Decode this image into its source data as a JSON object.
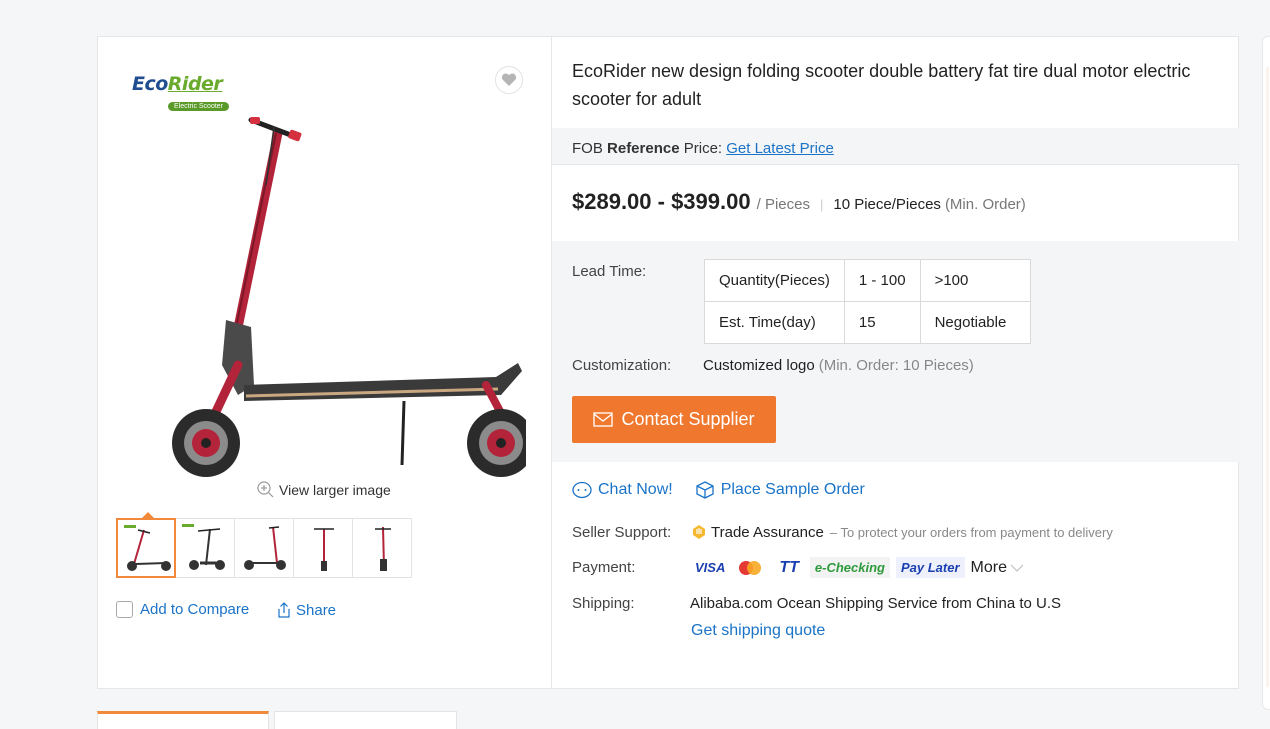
{
  "product": {
    "brand": {
      "logo_eco": "Eco",
      "logo_rider": "Rider",
      "logo_sub": "Electric Scooter"
    },
    "title": "EcoRider new design folding scooter double battery fat tire dual motor electric scooter for adult",
    "view_larger": "View larger image",
    "add_to_compare": "Add to Compare",
    "share": "Share",
    "thumbnail_count": 5,
    "accent_color": "#f0782e"
  },
  "pricing": {
    "fob_prefix": "FOB",
    "fob_bold": "Reference",
    "fob_suffix": "Price:",
    "fob_link": "Get Latest Price",
    "price_range": "$289.00 - $399.00",
    "price_unit": "/ Pieces",
    "moq": "10 Piece/Pieces",
    "moq_note": "(Min. Order)"
  },
  "lead_time": {
    "label": "Lead Time:",
    "rows": [
      [
        "Quantity(Pieces)",
        "1 - 100",
        ">100"
      ],
      [
        "Est. Time(day)",
        "15",
        "Negotiable"
      ]
    ]
  },
  "customization": {
    "label": "Customization:",
    "value": "Customized logo",
    "note": "(Min. Order: 10 Pieces)"
  },
  "contact_button": "Contact Supplier",
  "actions": {
    "chat": "Chat Now!",
    "sample": "Place Sample Order"
  },
  "seller_support": {
    "label": "Seller Support:",
    "value": "Trade Assurance",
    "note": "– To protect your orders from payment to delivery"
  },
  "payment": {
    "label": "Payment:",
    "methods": [
      "VISA",
      "TT",
      "e-Checking",
      "Pay Later"
    ],
    "more": "More"
  },
  "shipping": {
    "label": "Shipping:",
    "value": "Alibaba.com Ocean Shipping Service from China to U.S",
    "link": "Get shipping quote"
  }
}
